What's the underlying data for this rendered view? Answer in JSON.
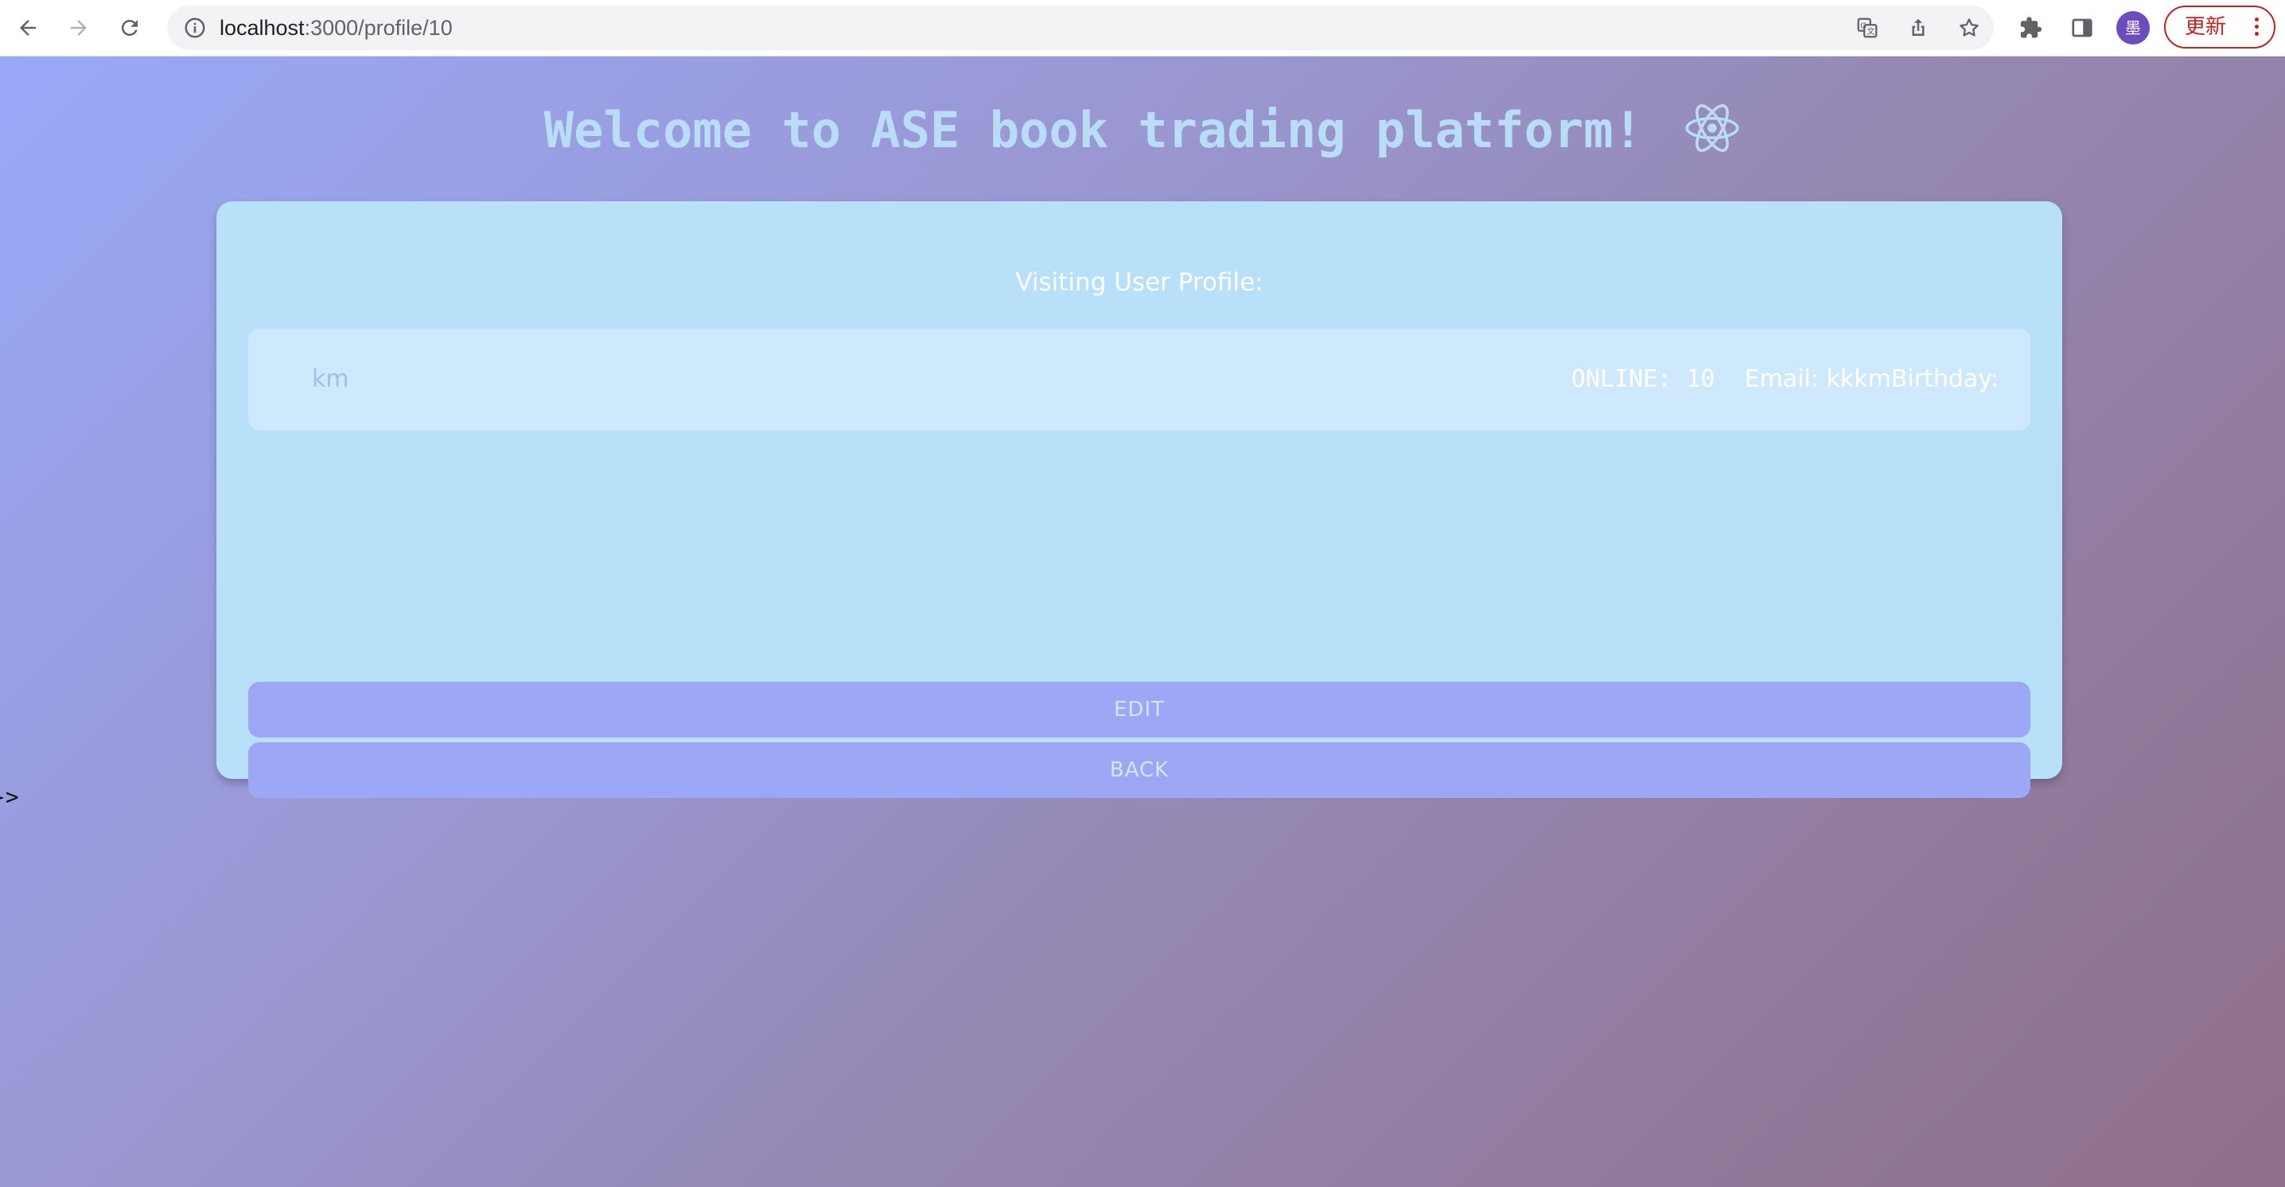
{
  "browser": {
    "url_host": "localhost",
    "url_path": ":3000/profile/10",
    "avatar_label": "墨",
    "update_label": "更新"
  },
  "page": {
    "headline": "Welcome to ASE book trading platform!",
    "card_title": "Visiting User Profile:",
    "profile": {
      "username": "km",
      "status": "ONLINE: 10",
      "email_label": "Email:",
      "email_value": "kkkm",
      "birthday_label": "Birthday:"
    },
    "buttons": {
      "edit": "EDIT",
      "back": "BACK"
    },
    "stray_text": "}>"
  }
}
